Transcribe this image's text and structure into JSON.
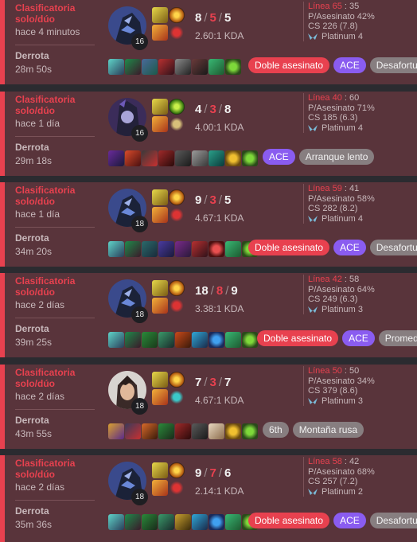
{
  "matches": [
    {
      "queue": "Clasificatoria solo/dúo",
      "ago": "hace 4 minutos",
      "result": "Derrota",
      "duration": "28m 50s",
      "level": "16",
      "kills": "8",
      "deaths": "5",
      "assists": "5",
      "kda": "2.60:1 KDA",
      "line_label": "Línea 65",
      "line_value": "35",
      "kp": "P/Asesinato 42%",
      "cs": "CS 226 (7.8)",
      "tier": "Platinum 4",
      "badges": [
        "Doble asesinato",
        "ACE",
        "Desafortunado"
      ]
    },
    {
      "queue": "Clasificatoria solo/dúo",
      "ago": "hace 1 día",
      "result": "Derrota",
      "duration": "29m 18s",
      "level": "16",
      "kills": "4",
      "deaths": "3",
      "assists": "8",
      "kda": "4.00:1 KDA",
      "line_label": "Línea 40",
      "line_value": "60",
      "kp": "P/Asesinato 71%",
      "cs": "CS 185 (6.3)",
      "tier": "Platinum 4",
      "badges": [
        "ACE",
        "Arranque lento"
      ]
    },
    {
      "queue": "Clasificatoria solo/dúo",
      "ago": "hace 1 día",
      "result": "Derrota",
      "duration": "34m 20s",
      "level": "18",
      "kills": "9",
      "deaths": "3",
      "assists": "5",
      "kda": "4.67:1 KDA",
      "line_label": "Línea 59",
      "line_value": "41",
      "kp": "P/Asesinato 58%",
      "cs": "CS 282 (8.2)",
      "tier": "Platinum 4",
      "badges": [
        "Doble asesinato",
        "ACE",
        "Desafortunado"
      ]
    },
    {
      "queue": "Clasificatoria solo/dúo",
      "ago": "hace 2 días",
      "result": "Derrota",
      "duration": "39m 25s",
      "level": "18",
      "kills": "18",
      "deaths": "8",
      "assists": "9",
      "kda": "3.38:1 KDA",
      "line_label": "Línea 42",
      "line_value": "58",
      "kp": "P/Asesinato 64%",
      "cs": "CS 249 (6.3)",
      "tier": "Platinum 3",
      "badges": [
        "Doble asesinato",
        "ACE",
        "Promedio"
      ]
    },
    {
      "queue": "Clasificatoria solo/dúo",
      "ago": "hace 2 días",
      "result": "Derrota",
      "duration": "43m 55s",
      "level": "18",
      "kills": "7",
      "deaths": "3",
      "assists": "7",
      "kda": "4.67:1 KDA",
      "line_label": "Línea 50",
      "line_value": "50",
      "kp": "P/Asesinato 34%",
      "cs": "CS 379 (8.6)",
      "tier": "Platinum 3",
      "badges": [
        "6th",
        "Montaña rusa"
      ]
    },
    {
      "queue": "Clasificatoria solo/dúo",
      "ago": "hace 2 días",
      "result": "Derrota",
      "duration": "35m 36s",
      "level": "18",
      "kills": "9",
      "deaths": "7",
      "assists": "6",
      "kda": "2.14:1 KDA",
      "line_label": "Línea 58",
      "line_value": "42",
      "kp": "P/Asesinato 68%",
      "cs": "CS 257 (7.2)",
      "tier": "Platinum 2",
      "badges": [
        "Doble asesinato",
        "ACE",
        "Desafortunado"
      ]
    }
  ],
  "badge_colors": {
    "Doble asesinato": "#e8414f",
    "ACE": "#8a5cf0"
  },
  "icons": {
    "champion": "champion-portrait-icon",
    "rune": "rune-icon",
    "item": "item-icon",
    "rank": "platinum-wing-icon"
  }
}
